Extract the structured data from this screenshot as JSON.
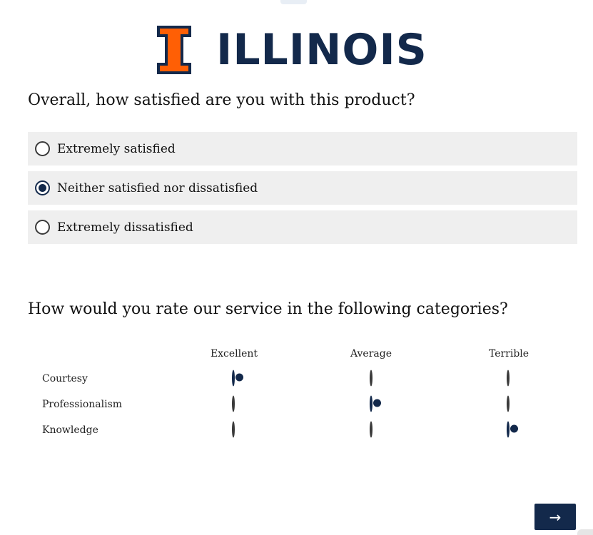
{
  "brand": {
    "logo_text": "ILLINOIS",
    "block_i_color": "#FF5F05",
    "navy": "#13294B"
  },
  "question1": {
    "title": "Overall, how satisfied are you with this product?",
    "choices": [
      {
        "label": "Extremely satisfied",
        "selected": false
      },
      {
        "label": "Neither satisfied nor dissatisfied",
        "selected": true
      },
      {
        "label": "Extremely dissatisfied",
        "selected": false
      }
    ]
  },
  "question2": {
    "title": "How would you rate our service in the following categories?",
    "columns": [
      "Excellent",
      "Average",
      "Terrible"
    ],
    "rows": [
      {
        "label": "Courtesy",
        "selected": "Excellent"
      },
      {
        "label": "Professionalism",
        "selected": "Average"
      },
      {
        "label": "Knowledge",
        "selected": "Terrible"
      }
    ]
  },
  "navigation": {
    "next_label": "→",
    "next_icon": "arrow-right-icon"
  }
}
